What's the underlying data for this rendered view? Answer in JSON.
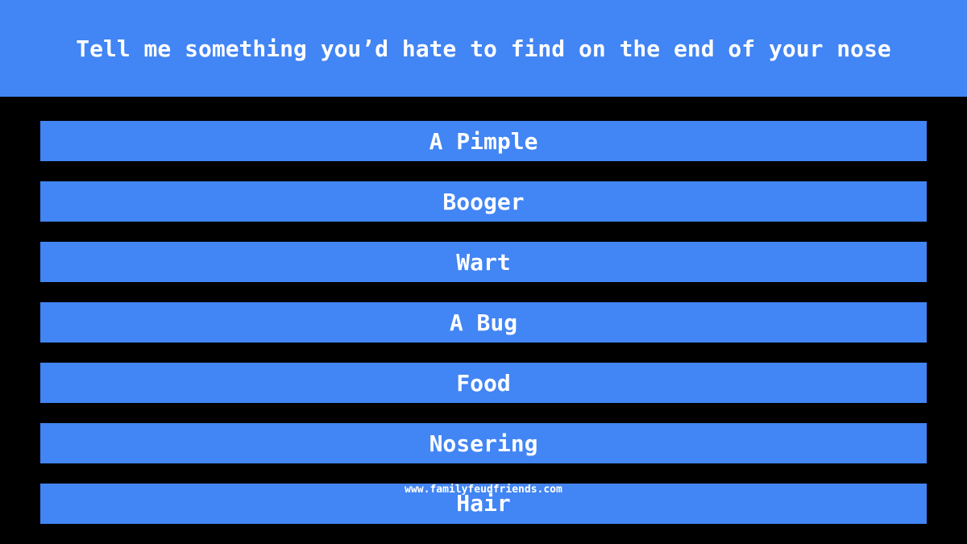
{
  "question": "Tell me something you’d hate to find on the end of your nose",
  "answers": [
    "A Pimple",
    "Booger",
    "Wart",
    "A Bug",
    "Food",
    "Nosering",
    "Hair"
  ],
  "footer": "www.familyfeudfriends.com",
  "colors": {
    "accent": "#4285f4",
    "background": "#000000",
    "text": "#ffffff"
  }
}
